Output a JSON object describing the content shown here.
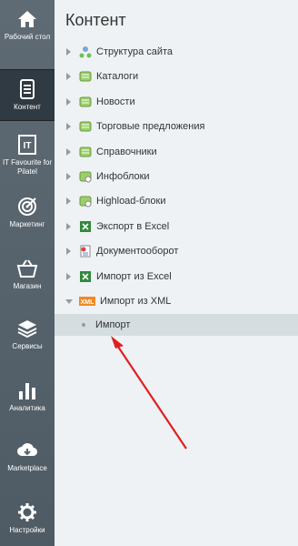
{
  "sidebar": {
    "items": [
      {
        "label": "Рабочий стол",
        "icon": "home-icon"
      },
      {
        "label": "Контент",
        "icon": "document-icon"
      },
      {
        "label": "IT Favourite for Pilatel",
        "icon": "it-logo-icon"
      },
      {
        "label": "Маркетинг",
        "icon": "target-icon"
      },
      {
        "label": "Магазин",
        "icon": "basket-icon"
      },
      {
        "label": "Сервисы",
        "icon": "layers-icon"
      },
      {
        "label": "Аналитика",
        "icon": "bar-chart-icon"
      },
      {
        "label": "Marketplace",
        "icon": "cloud-download-icon"
      },
      {
        "label": "Настройки",
        "icon": "gear-icon"
      }
    ]
  },
  "panel": {
    "title": "Контент",
    "tree": [
      {
        "label": "Структура сайта",
        "icon": "site-structure-icon"
      },
      {
        "label": "Каталоги",
        "icon": "catalog-icon"
      },
      {
        "label": "Новости",
        "icon": "news-icon"
      },
      {
        "label": "Торговые предложения",
        "icon": "offers-icon"
      },
      {
        "label": "Справочники",
        "icon": "reference-icon"
      },
      {
        "label": "Инфоблоки",
        "icon": "infoblock-icon"
      },
      {
        "label": "Highload-блоки",
        "icon": "highload-icon"
      },
      {
        "label": "Экспорт в Excel",
        "icon": "excel-icon"
      },
      {
        "label": "Документооборот",
        "icon": "document-flow-icon"
      },
      {
        "label": "Импорт из Excel",
        "icon": "excel-icon"
      },
      {
        "label": "Импорт из XML",
        "icon": "xml-icon"
      }
    ],
    "subitem": {
      "label": "Импорт"
    }
  }
}
